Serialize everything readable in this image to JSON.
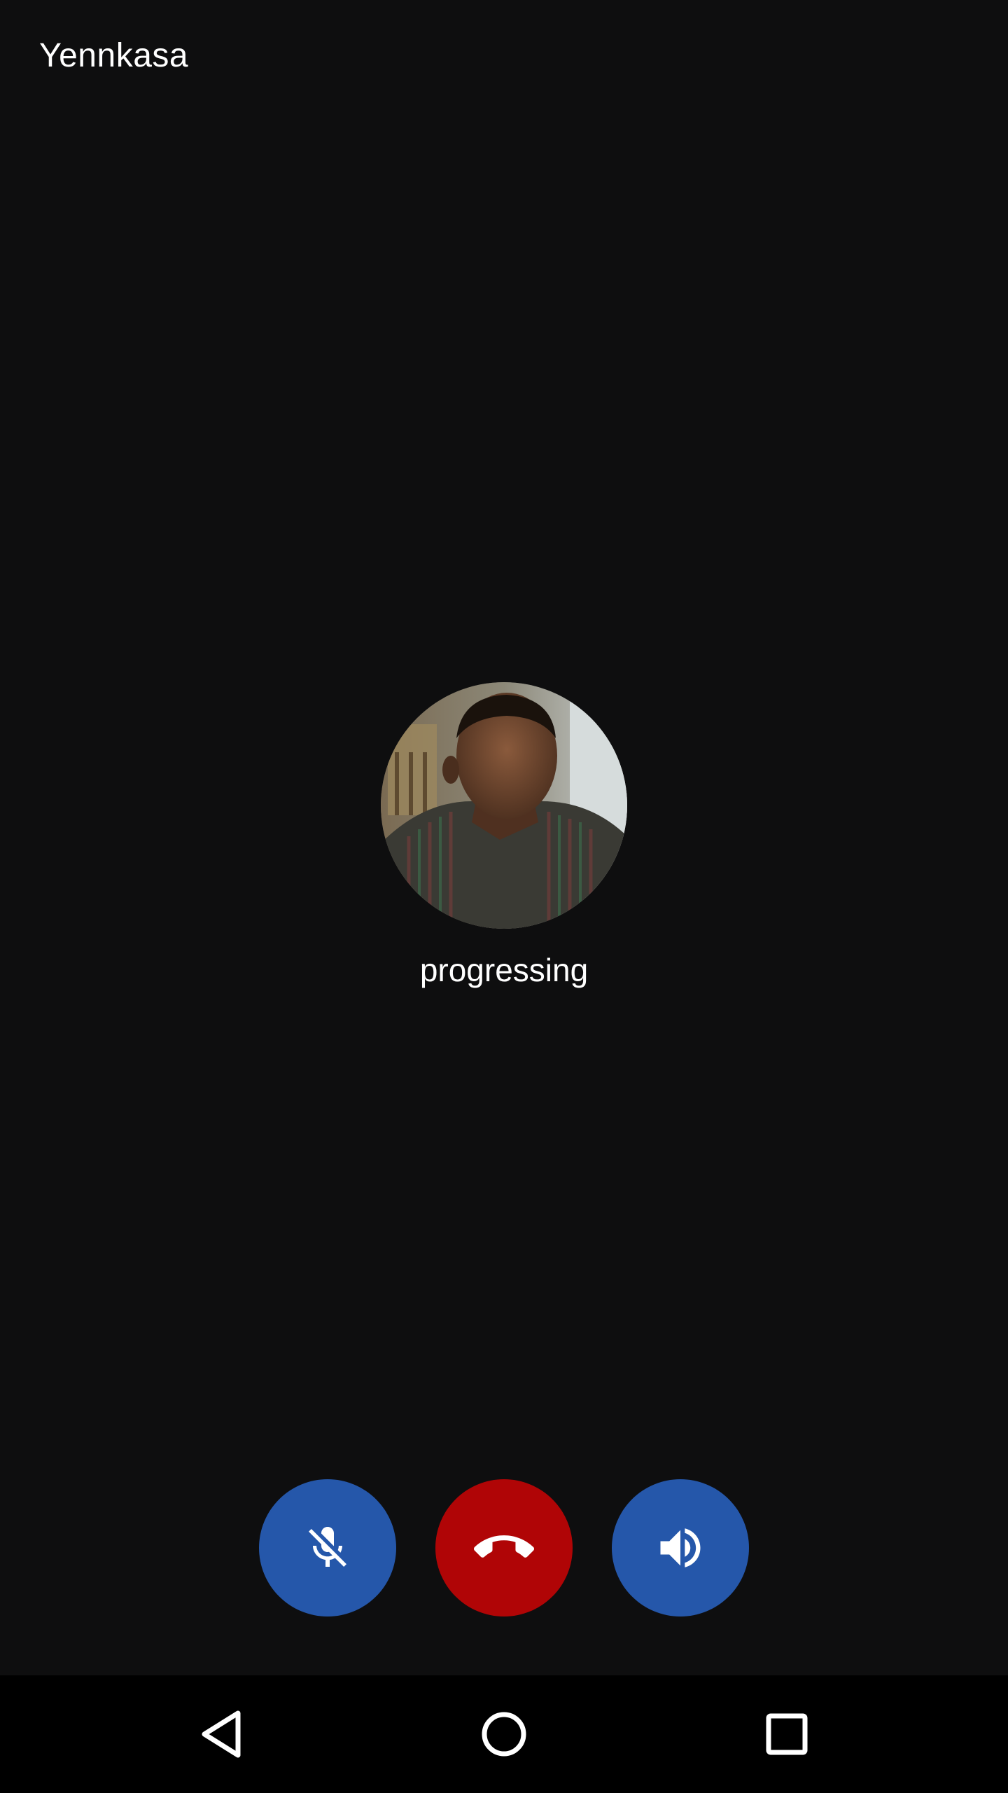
{
  "call": {
    "caller_name": "Yennkasa",
    "status": "progressing"
  },
  "avatar": {
    "description_icon": "contact-photo"
  },
  "controls": {
    "mute_icon": "mic-off-icon",
    "hangup_icon": "call-end-icon",
    "speaker_icon": "volume-up-icon"
  },
  "colors": {
    "background": "#0e0e0f",
    "control_blue": "#2557aa",
    "hangup_red": "#b00506",
    "navbar": "#000000",
    "text": "#ffffff"
  },
  "navbar": {
    "items": [
      "back-icon",
      "home-icon",
      "recents-icon"
    ]
  }
}
